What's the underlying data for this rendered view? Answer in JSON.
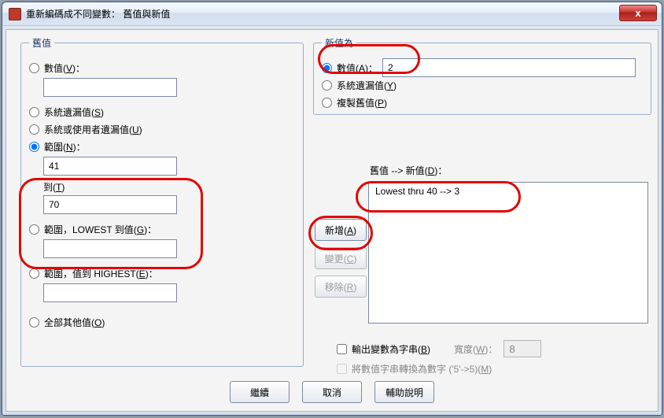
{
  "window": {
    "title": "重新編碼成不同變數： 舊值與新值",
    "close": "x"
  },
  "old": {
    "legend": "舊值",
    "value_label_pre": "數值(",
    "value_key": "V",
    "value_label_post": ")：",
    "value": "",
    "sysmis_pre": "系統遺漏值(",
    "sysmis_key": "S",
    "sysmis_post": ")",
    "usermis_pre": "系統或使用者遺漏值(",
    "usermis_key": "U",
    "usermis_post": ")",
    "range_pre": "範圍(",
    "range_key": "N",
    "range_post": ")：",
    "range_from": "41",
    "range_to_label_pre": "到(",
    "range_to_key": "T",
    "range_to_label_post": ")",
    "range_to": "70",
    "range_low_pre": "範圍，LOWEST 到值(",
    "range_low_key": "G",
    "range_low_post": ")：",
    "range_low": "",
    "range_high_pre": "範圍，值到 HIGHEST(",
    "range_high_key": "E",
    "range_high_post": ")：",
    "range_high": "",
    "all_other_pre": "全部其他值(",
    "all_other_key": "O",
    "all_other_post": ")"
  },
  "new": {
    "legend": "新值為",
    "value_label_pre": "數值(",
    "value_key": "A",
    "value_label_post": ")：",
    "value": "2",
    "sysmis_pre": "系統遺漏值(",
    "sysmis_key": "Y",
    "sysmis_post": ")",
    "copy_pre": "複製舊值(",
    "copy_key": "P",
    "copy_post": ")"
  },
  "mapping": {
    "label_pre": "舊值 --> 新值(",
    "label_key": "D",
    "label_post": ")：",
    "items": [
      "Lowest thru 40 --> 3"
    ]
  },
  "buttons": {
    "add_pre": "新增(",
    "add_key": "A",
    "add_post": ")",
    "change_pre": "變更(",
    "change_key": "C",
    "change_post": ")",
    "remove_pre": "移除(",
    "remove_key": "R",
    "remove_post": ")"
  },
  "output": {
    "string_pre": "輸出變數為字串(",
    "string_key": "B",
    "string_post": ")",
    "width_pre": "寬度(",
    "width_key": "W",
    "width_post": ")：",
    "width_value": "8",
    "convert_pre": "將數值字串轉換為數字 ('5'->5)(",
    "convert_key": "M",
    "convert_post": ")"
  },
  "dlg": {
    "continue": "繼續",
    "cancel": "取消",
    "help": "輔助說明"
  }
}
